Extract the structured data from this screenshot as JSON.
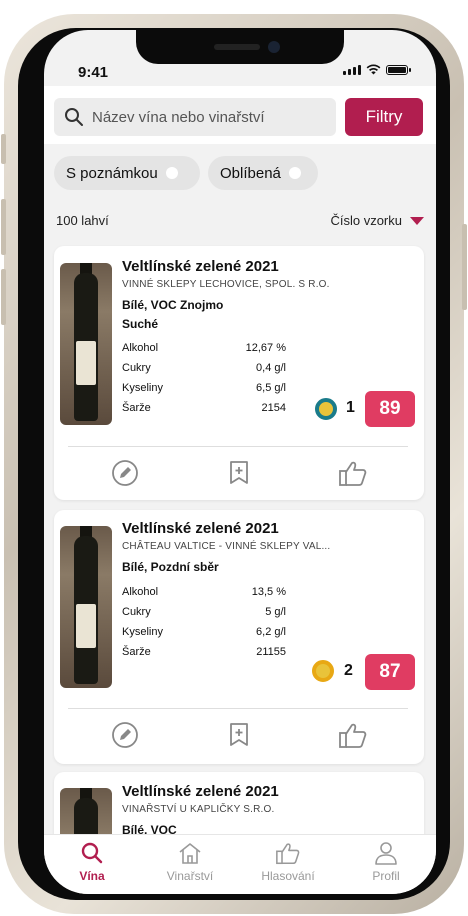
{
  "status": {
    "time": "9:41"
  },
  "search": {
    "placeholder": "Název vína nebo vinařství"
  },
  "filter_button": "Filtry",
  "chips": [
    {
      "label": "S poznámkou"
    },
    {
      "label": "Oblíbená"
    }
  ],
  "count_label": "100 lahví",
  "sort_label": "Číslo vzorku",
  "wines": [
    {
      "name": "Veltlínské zelené 2021",
      "producer": "VINNÉ SKLEPY LECHOVICE, SPOL. S R.O.",
      "subtitle_1": "Bílé, VOC Znojmo",
      "subtitle_2": "Suché",
      "stats": [
        {
          "label": "Alkohol",
          "value": "12,67 %"
        },
        {
          "label": "Cukry",
          "value": "0,4 g/l"
        },
        {
          "label": "Kyseliny",
          "value": "6,5 g/l"
        },
        {
          "label": "Šarže",
          "value": "2154"
        }
      ],
      "rank": "1",
      "medal_color": "#e9c33a",
      "medal_ring": "#1a7b8a",
      "score": "89"
    },
    {
      "name": "Veltlínské zelené 2021",
      "producer": "CHÂTEAU VALTICE - VINNÉ SKLEPY VAL...",
      "subtitle_1": "Bílé, Pozdní sběr",
      "stats": [
        {
          "label": "Alkohol",
          "value": "13,5 %"
        },
        {
          "label": "Cukry",
          "value": "5 g/l"
        },
        {
          "label": "Kyseliny",
          "value": "6,2 g/l"
        },
        {
          "label": "Šarže",
          "value": "21155"
        }
      ],
      "rank": "2",
      "medal_color": "#e9c33a",
      "medal_ring": "#e8a814",
      "score": "87"
    },
    {
      "name": "Veltlínské zelené 2021",
      "producer": "VINAŘSTVÍ U KAPLIČKY S.R.O.",
      "subtitle_1": "Bílé, VOC"
    }
  ],
  "tabs": [
    {
      "label": "Vína",
      "icon": "search-icon"
    },
    {
      "label": "Vinařství",
      "icon": "home-icon"
    },
    {
      "label": "Hlasování",
      "icon": "thumbs-up-icon"
    },
    {
      "label": "Profil",
      "icon": "person-icon"
    }
  ],
  "colors": {
    "accent": "#b11e4f",
    "score_bg": "#e03c62"
  }
}
